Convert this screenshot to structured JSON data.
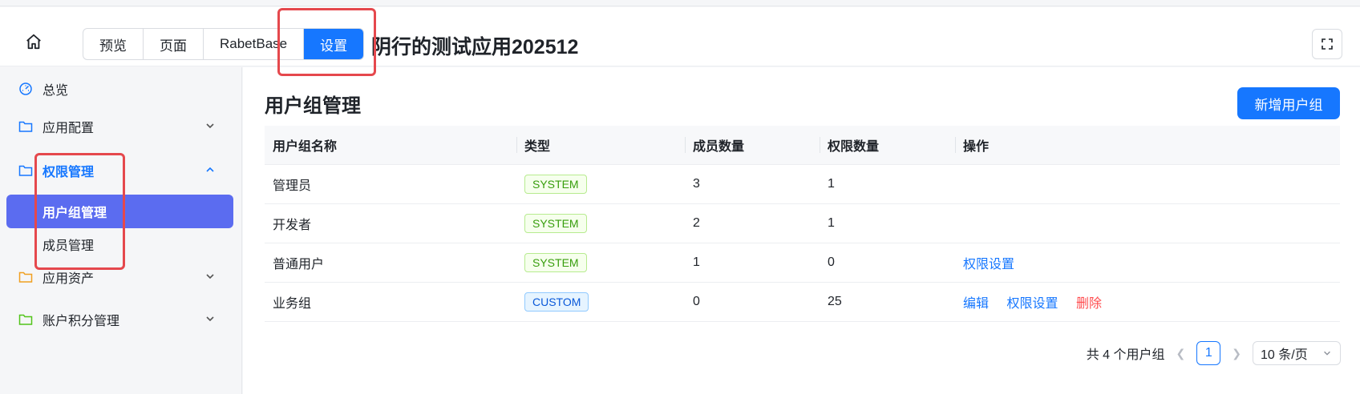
{
  "header": {
    "tabs": [
      "预览",
      "页面",
      "RabetBase",
      "设置"
    ],
    "active_tab": "设置",
    "app_title": "阴行的测试应用202512"
  },
  "sidebar": {
    "items": [
      {
        "label": "总览",
        "icon": "dashboard-icon"
      },
      {
        "label": "应用配置",
        "icon": "folder-icon",
        "expandable": true
      },
      {
        "label": "权限管理",
        "icon": "folder-icon",
        "expanded": true
      },
      {
        "label": "应用资产",
        "icon": "folder-icon",
        "expandable": true
      },
      {
        "label": "账户积分管理",
        "icon": "folder-icon",
        "expandable": true
      }
    ],
    "sub_items": [
      {
        "label": "用户组管理",
        "active": true
      },
      {
        "label": "成员管理"
      }
    ]
  },
  "main": {
    "title": "用户组管理",
    "add_button": "新增用户组",
    "columns": [
      "用户组名称",
      "类型",
      "成员数量",
      "权限数量",
      "操作"
    ],
    "rows": [
      {
        "name": "管理员",
        "type": "SYSTEM",
        "members": "3",
        "perms": "1",
        "ops": []
      },
      {
        "name": "开发者",
        "type": "SYSTEM",
        "members": "2",
        "perms": "1",
        "ops": []
      },
      {
        "name": "普通用户",
        "type": "SYSTEM",
        "members": "1",
        "perms": "0",
        "ops": [
          "权限设置"
        ]
      },
      {
        "name": "业务组",
        "type": "CUSTOM",
        "members": "0",
        "perms": "25",
        "ops": [
          "编辑",
          "权限设置",
          "删除"
        ]
      }
    ],
    "pagination": {
      "total_text": "共 4 个用户组",
      "current_page": "1",
      "page_size": "10 条/页"
    }
  },
  "colors": {
    "accent": "#1677ff",
    "active_nav": "#5b6cf0",
    "danger": "#ff4d4f",
    "highlight": "#e5484d"
  }
}
